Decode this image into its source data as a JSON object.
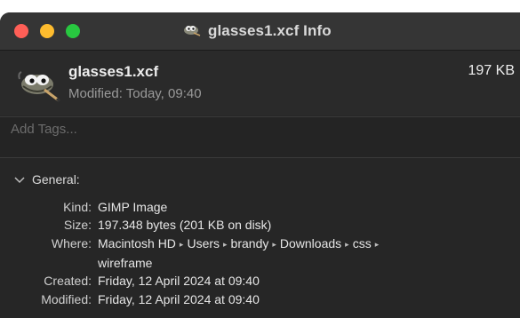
{
  "window": {
    "title": "glasses1.xcf Info"
  },
  "file": {
    "name": "glasses1.xcf",
    "modified": "Modified: Today, 09:40",
    "size": "197 KB",
    "icon": "gimp-icon"
  },
  "tags": {
    "placeholder": "Add Tags..."
  },
  "general": {
    "heading": "General:",
    "rows": [
      {
        "label": "Kind:",
        "value": "GIMP Image"
      },
      {
        "label": "Size:",
        "value": "197.348 bytes (201 KB on disk)"
      },
      {
        "label": "Where:",
        "path": [
          "Macintosh HD",
          "Users",
          "brandy",
          "Downloads",
          "css"
        ],
        "path_tail": "wireframe"
      },
      {
        "label": "Created:",
        "value": "Friday, 12 April 2024 at 09:40"
      },
      {
        "label": "Modified:",
        "value": "Friday, 12 April 2024 at 09:40"
      }
    ],
    "path_separator": "▸"
  },
  "colors": {
    "close": "#ff5f57",
    "minimize": "#febc2e",
    "zoom": "#28c840",
    "background": "#262626"
  }
}
